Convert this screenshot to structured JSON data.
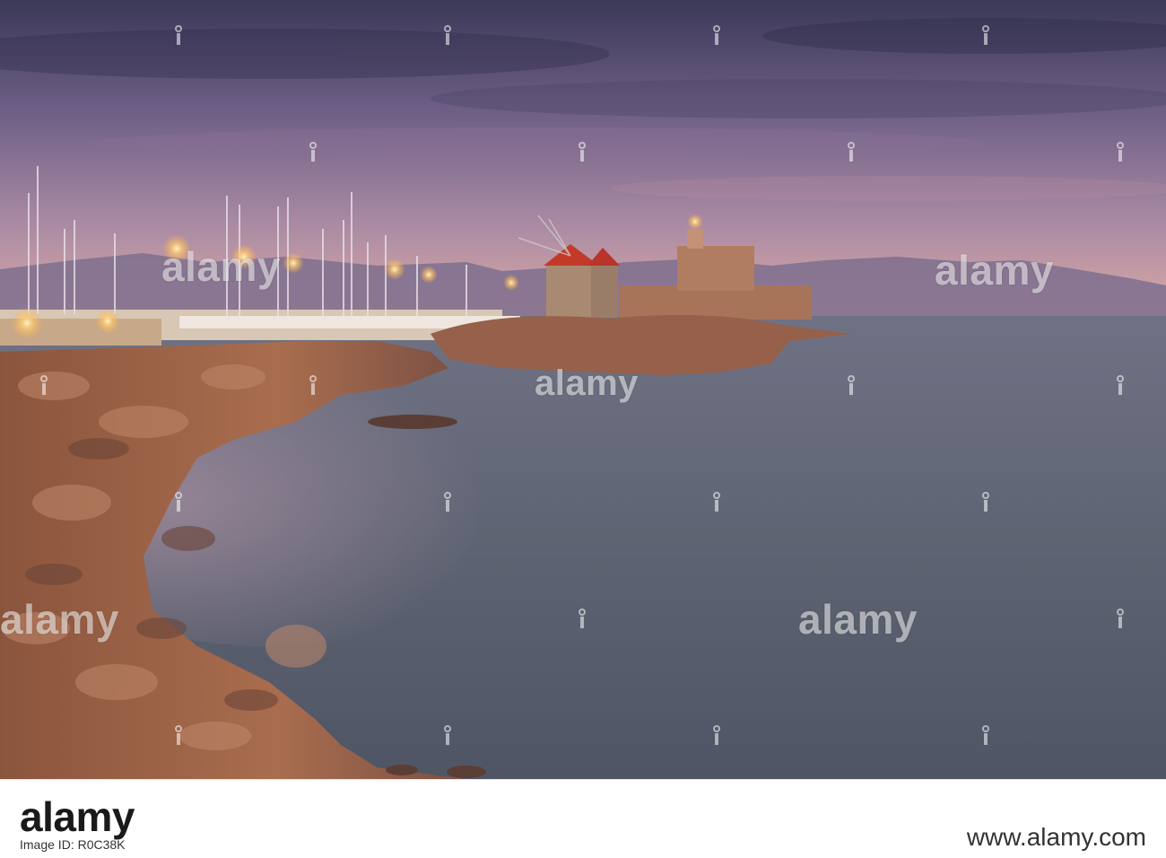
{
  "watermark": {
    "text": "alamy"
  },
  "footer": {
    "logo_text": "alamy",
    "image_id": "Image ID: R0C38K",
    "url": "www.alamy.com"
  },
  "colors": {
    "sky_top": "#3d3a5a",
    "sky_mid": "#7a6a8e",
    "sky_horizon": "#d9a7a6",
    "sea": "#5f6473",
    "rocks": "#a86a4f",
    "windmill_roof": "#c23a2a",
    "light_glow": "#ffd27a"
  }
}
